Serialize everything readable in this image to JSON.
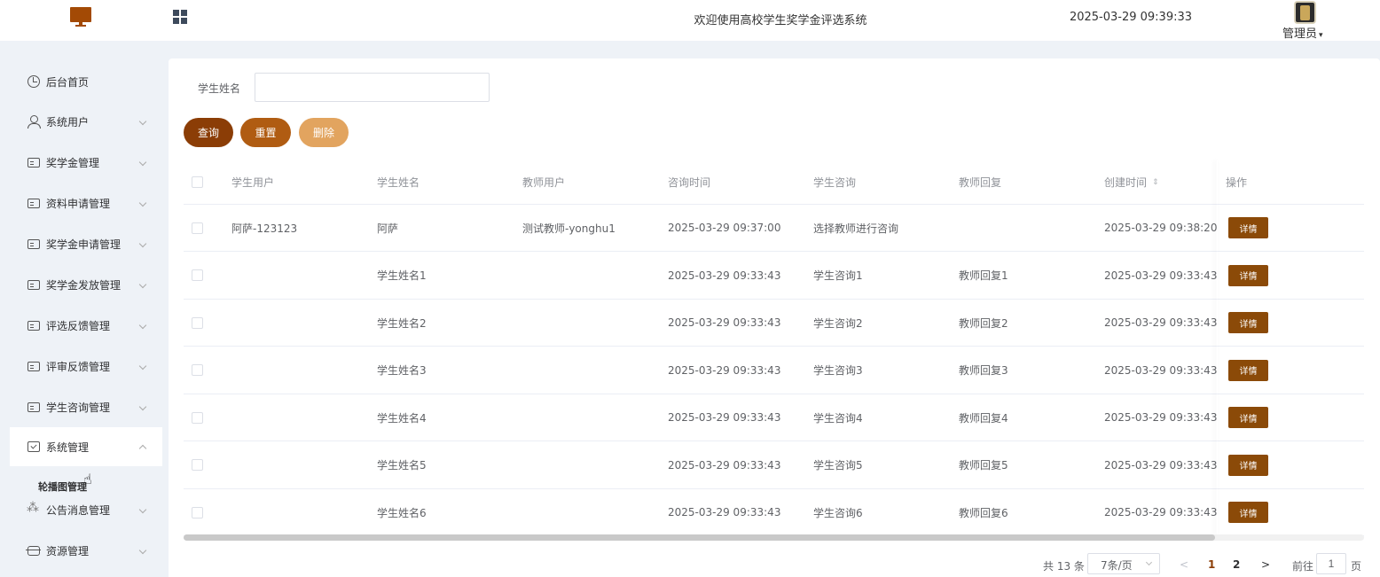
{
  "header": {
    "title": "欢迎使用高校学生奖学金评选系统",
    "datetime": "2025-03-29 09:39:33",
    "user": "管理员"
  },
  "sidebar": {
    "items": [
      {
        "label": "后台首页",
        "icon": "clock-icon"
      },
      {
        "label": "系统用户",
        "icon": "user-icon"
      },
      {
        "label": "奖学金管理",
        "icon": "card-icon"
      },
      {
        "label": "资料申请管理",
        "icon": "card-icon"
      },
      {
        "label": "奖学金申请管理",
        "icon": "card-icon"
      },
      {
        "label": "奖学金发放管理",
        "icon": "card-icon"
      },
      {
        "label": "评选反馈管理",
        "icon": "card-icon"
      },
      {
        "label": "评审反馈管理",
        "icon": "card-icon"
      },
      {
        "label": "学生咨询管理",
        "icon": "card-icon"
      },
      {
        "label": "系统管理",
        "icon": "folder-icon"
      },
      {
        "label": "公告消息管理",
        "icon": "sparkle-icon"
      },
      {
        "label": "资源管理",
        "icon": "box-icon"
      }
    ],
    "sub_item": "轮播图管理"
  },
  "search": {
    "label": "学生姓名",
    "value": "",
    "placeholder": ""
  },
  "buttons": {
    "query": "查询",
    "reset": "重置",
    "delete": "删除"
  },
  "table": {
    "columns": [
      "学生用户",
      "学生姓名",
      "教师用户",
      "咨询时间",
      "学生咨询",
      "教师回复",
      "创建时间",
      "操作"
    ],
    "sort_icon": "sort-icon",
    "action_label": "详情",
    "rows": [
      {
        "student_user": "阿萨-123123",
        "student_name": "阿萨",
        "teacher_user": "测试教师-yonghu1",
        "consult_time": "2025-03-29 09:37:00",
        "consult": "选择教师进行咨询",
        "reply": "",
        "created": "2025-03-29 09:38:20"
      },
      {
        "student_user": "",
        "student_name": "学生姓名1",
        "teacher_user": "",
        "consult_time": "2025-03-29 09:33:43",
        "consult": "学生咨询1",
        "reply": "教师回复1",
        "created": "2025-03-29 09:33:43"
      },
      {
        "student_user": "",
        "student_name": "学生姓名2",
        "teacher_user": "",
        "consult_time": "2025-03-29 09:33:43",
        "consult": "学生咨询2",
        "reply": "教师回复2",
        "created": "2025-03-29 09:33:43"
      },
      {
        "student_user": "",
        "student_name": "学生姓名3",
        "teacher_user": "",
        "consult_time": "2025-03-29 09:33:43",
        "consult": "学生咨询3",
        "reply": "教师回复3",
        "created": "2025-03-29 09:33:43"
      },
      {
        "student_user": "",
        "student_name": "学生姓名4",
        "teacher_user": "",
        "consult_time": "2025-03-29 09:33:43",
        "consult": "学生咨询4",
        "reply": "教师回复4",
        "created": "2025-03-29 09:33:43"
      },
      {
        "student_user": "",
        "student_name": "学生姓名5",
        "teacher_user": "",
        "consult_time": "2025-03-29 09:33:43",
        "consult": "学生咨询5",
        "reply": "教师回复5",
        "created": "2025-03-29 09:33:43"
      },
      {
        "student_user": "",
        "student_name": "学生姓名6",
        "teacher_user": "",
        "consult_time": "2025-03-29 09:33:43",
        "consult": "学生咨询6",
        "reply": "教师回复6",
        "created": "2025-03-29 09:33:43"
      }
    ]
  },
  "pagination": {
    "total": "共 13 条",
    "page_size": "7条/页",
    "prev": "<",
    "pages": [
      "1",
      "2"
    ],
    "current": "1",
    "next": ">",
    "goto_prefix": "前往",
    "goto_value": "1",
    "goto_suffix": "页"
  },
  "colors": {
    "primary": "#8b3d06",
    "secondary": "#b05c12",
    "light": "#e2a45f",
    "background": "#eef2f7"
  }
}
